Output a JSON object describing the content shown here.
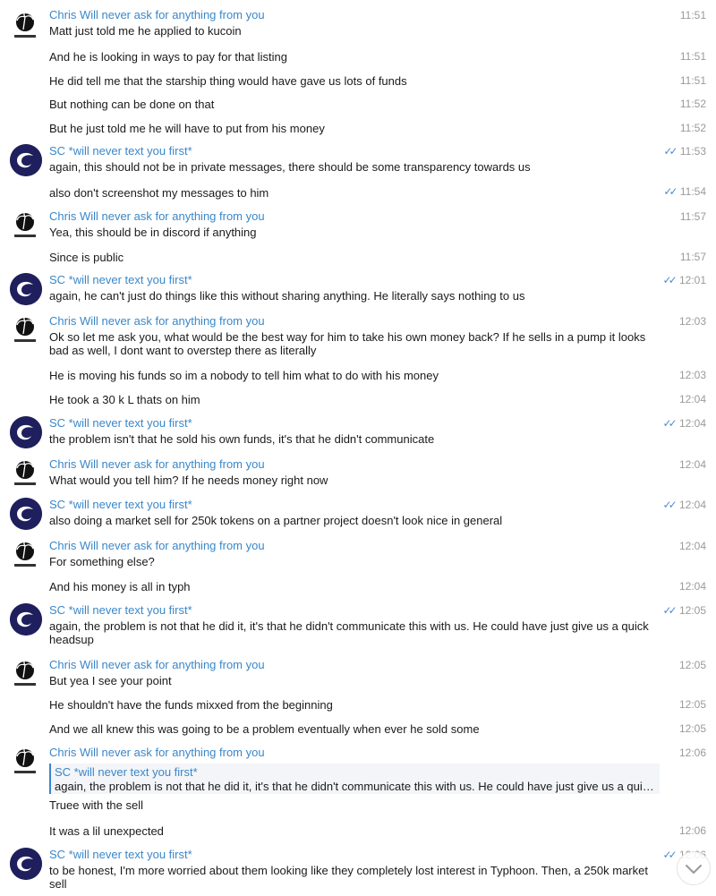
{
  "senders": {
    "chris": "Chris Will never ask for anything from you",
    "sc": "SC *will never text you first*"
  },
  "icons": {
    "chris_avatar": "palm-tree-logo-icon",
    "sc_avatar": "typhoon-swirl-icon",
    "read_ticks": "double-check-icon",
    "scroll_down": "chevron-down-icon"
  },
  "colors": {
    "sender_name": "#3a87c9",
    "read_ticks": "#4d8dd1",
    "time": "#9a9a9a",
    "sc_avatar_bg": "#1f1f5e"
  },
  "messages": [
    {
      "time": "11:51",
      "text": "Matt just told me he applied to kucoin"
    },
    {
      "time": "11:51",
      "text": "And he is looking in ways to pay for that listing"
    },
    {
      "time": "11:51",
      "text": "He did tell me that the starship thing would have gave us lots of funds"
    },
    {
      "time": "11:52",
      "text": "But nothing can be done on that"
    },
    {
      "time": "11:52",
      "text": "But he just told me he will have to put from his money"
    },
    {
      "time": "11:53",
      "text": "again, this should not be in private messages, there should be some transparency towards us"
    },
    {
      "time": "11:54",
      "text": "also don't screenshot my messages to him"
    },
    {
      "time": "11:57",
      "text": "Yea, this should be in discord if anything"
    },
    {
      "time": "11:57",
      "text": "Since is public"
    },
    {
      "time": "12:01",
      "text": "again, he can't just do things like this without sharing anything. He literally says nothing to us"
    },
    {
      "time": "12:03",
      "text": "Ok so let me ask you, what would be the best way for him to take his own money back? If he sells in a pump it looks bad as well, I dont want to overstep there as literally"
    },
    {
      "time": "12:03",
      "text": "He is moving his funds so im a nobody to tell him what to do with his money"
    },
    {
      "time": "12:04",
      "text": "He took a 30 k L thats on him"
    },
    {
      "time": "12:04",
      "text": "the problem isn't that he sold his own funds, it's that he didn't communicate"
    },
    {
      "time": "12:04",
      "text": "What would you tell him? If he needs money right now"
    },
    {
      "time": "12:04",
      "text": "also doing a market sell for 250k tokens on a partner project doesn't look nice in general"
    },
    {
      "time": "12:04",
      "text": "For something else?"
    },
    {
      "time": "12:04",
      "text": "And his money is all in typh"
    },
    {
      "time": "12:05",
      "text": "again, the problem is not that he did it, it's that he didn't communicate this with us. He could have just give us a quick headsup"
    },
    {
      "time": "12:05",
      "text": "But yea I see your point"
    },
    {
      "time": "12:05",
      "text": "He shouldn't have the funds mixxed from the beginning"
    },
    {
      "time": "12:05",
      "text": "And we all knew this was going to be a problem eventually when ever he sold some"
    },
    {
      "time": "12:06",
      "text": "Truee with the sell",
      "reply_name": "SC *will never text you first*",
      "reply_text": "again, the problem is not that he did it, it's that he didn't communicate this with us. He could have just give us a qui…"
    },
    {
      "time": "12:06",
      "text": "It was  a lil unexpected"
    },
    {
      "time": "12:06",
      "text": "to be honest, I'm more worried about them looking like they completely lost interest in Typhoon. Then, a 250k market sell"
    }
  ]
}
